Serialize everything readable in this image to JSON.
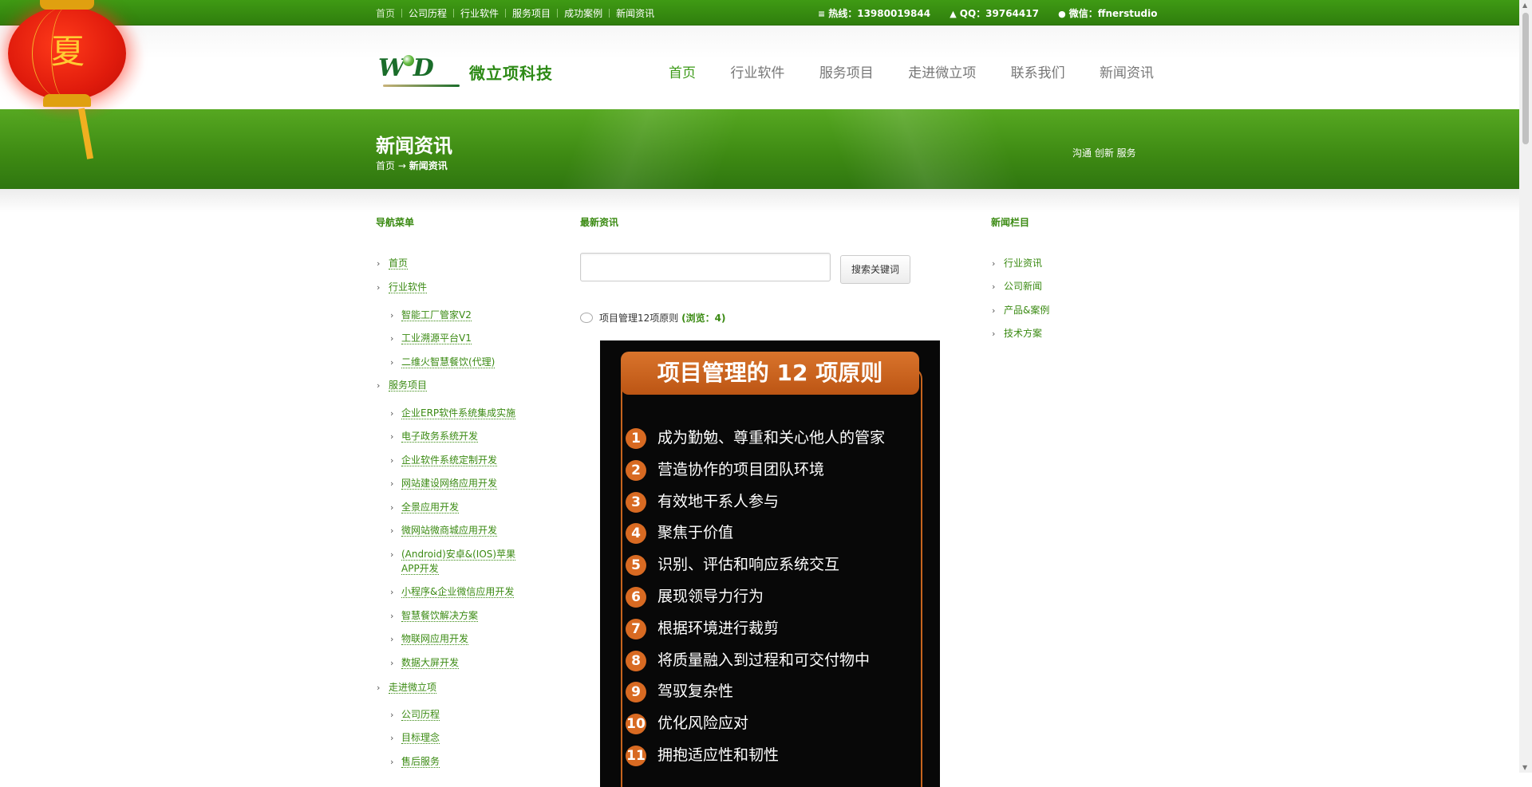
{
  "topbar": {
    "links": [
      "首页",
      "公司历程",
      "行业软件",
      "服务项目",
      "成功案例",
      "新闻资讯"
    ],
    "hotline_label": "热线：",
    "hotline": "13980019844",
    "qq_label": "QQ：",
    "qq": "39764417",
    "wechat_label": "微信：",
    "wechat": "ffnerstudio"
  },
  "lantern": {
    "char": "夏"
  },
  "logo": {
    "mark": "WLD",
    "text": "微立项科技"
  },
  "mainnav": [
    "首页",
    "行业软件",
    "服务项目",
    "走进微立项",
    "联系我们",
    "新闻资讯"
  ],
  "banner": {
    "title": "新闻资讯",
    "crumb_home": "首页",
    "crumb_arrow": "→",
    "crumb_current": "新闻资讯",
    "slogan": "沟通 创新 服务"
  },
  "leftnav": {
    "heading": "导航菜单",
    "items": [
      "首页",
      "行业软件",
      "智能工厂管家V2",
      "工业溯源平台V1",
      "二维火智慧餐饮(代理)",
      "服务项目",
      "企业ERP软件系统集成实施",
      "电子政务系统开发",
      "企业软件系统定制开发",
      "网站建设网络应用开发",
      "全景应用开发",
      "微网站微商城应用开发",
      "(Android)安卓&(IOS)苹果",
      "APP开发",
      "小程序&企业微信应用开发",
      "智慧餐饮解决方案",
      "物联网应用开发",
      "数据大屏开发",
      "走进微立项",
      "公司历程",
      "目标理念",
      "售后服务"
    ]
  },
  "main": {
    "heading": "最新资讯",
    "search_placeholder": "",
    "search_button": "搜索关键词",
    "article_title": "项目管理12项原则",
    "article_views": "(浏览：4)",
    "poster_title": "项目管理的 12 项原则",
    "principles": [
      "成为勤勉、尊重和关心他人的管家",
      "营造协作的项目团队环境",
      "有效地干系人参与",
      "聚焦于价值",
      "识别、评估和响应系统交互",
      "展现领导力行为",
      "根据环境进行裁剪",
      "将质量融入到过程和可交付物中",
      "驾驭复杂性",
      "优化风险应对",
      "拥抱适应性和韧性"
    ],
    "principle_numbers": [
      "1",
      "2",
      "3",
      "4",
      "5",
      "6",
      "7",
      "8",
      "9",
      "10",
      "11"
    ]
  },
  "rightnav": {
    "heading": "新闻栏目",
    "items": [
      "行业资讯",
      "公司新闻",
      "产品&案例",
      "技术方案"
    ]
  },
  "colors": {
    "brand_green": "#3c9a18",
    "poster_orange": "#d86a22"
  }
}
